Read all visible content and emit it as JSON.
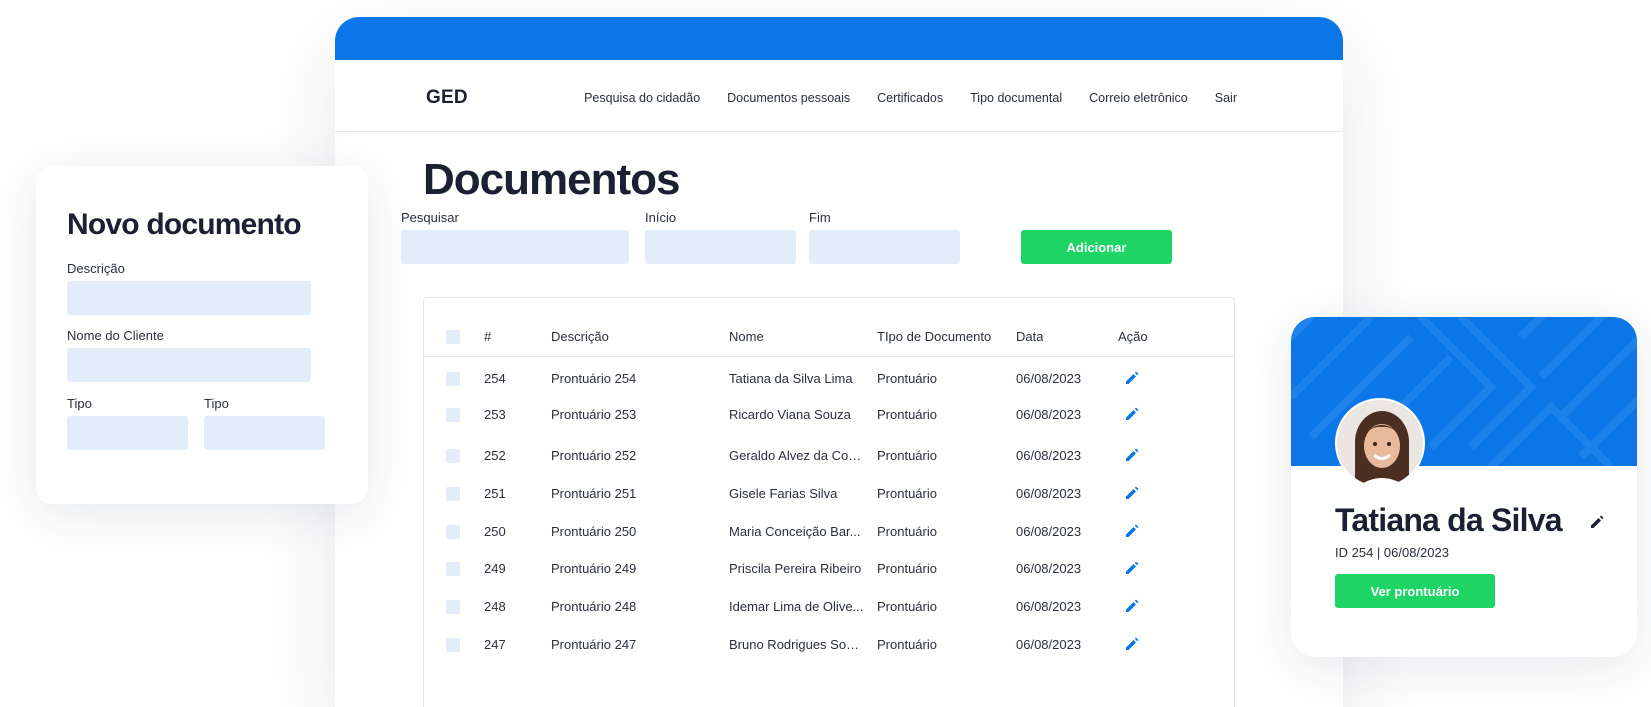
{
  "app": {
    "logo": "GED",
    "nav": [
      "Pesquisa do cidadão",
      "Documentos pessoais",
      "Certificados",
      "Tipo documental",
      "Correio eletrônico",
      "Sair"
    ],
    "page_title": "Documentos",
    "filters": {
      "search_label": "Pesquisar",
      "start_label": "Início",
      "end_label": "Fim",
      "search_value": "",
      "start_value": "",
      "end_value": ""
    },
    "add_button": "Adicionar",
    "colors": {
      "primary": "#0b76e8",
      "accent": "#1dd465",
      "input_bg": "#e3ecf9"
    }
  },
  "table": {
    "headers": [
      "#",
      "Descrição",
      "Nome",
      "TIpo de Documento",
      "Data",
      "Ação"
    ],
    "rows": [
      {
        "id": "254",
        "desc": "Prontuário 254",
        "name": "Tatiana da Silva Lima",
        "type": "Prontuário",
        "date": "06/08/2023"
      },
      {
        "id": "253",
        "desc": "Prontuário 253",
        "name": "Ricardo Viana Souza",
        "type": "Prontuário",
        "date": "06/08/2023"
      },
      {
        "id": "252",
        "desc": "Prontuário 252",
        "name": "Geraldo Alvez da Cos...",
        "type": "Prontuário",
        "date": "06/08/2023"
      },
      {
        "id": "251",
        "desc": "Prontuário 251",
        "name": "Gisele Farias Silva",
        "type": "Prontuário",
        "date": "06/08/2023"
      },
      {
        "id": "250",
        "desc": "Prontuário 250",
        "name": "Maria Conceição Bar...",
        "type": "Prontuário",
        "date": "06/08/2023"
      },
      {
        "id": "249",
        "desc": "Prontuário 249",
        "name": "Priscila Pereira Ribeiro",
        "type": "Prontuário",
        "date": "06/08/2023"
      },
      {
        "id": "248",
        "desc": "Prontuário 248",
        "name": "Idemar Lima de Olive...",
        "type": "Prontuário",
        "date": "06/08/2023"
      },
      {
        "id": "247",
        "desc": "Prontuário 247",
        "name": "Bruno Rodrigues Sou...",
        "type": "Prontuário",
        "date": "06/08/2023"
      }
    ],
    "action_icon": "pencil-icon"
  },
  "form": {
    "title": "Novo documento",
    "descricao_label": "Descrição",
    "cliente_label": "Nome do Cliente",
    "tipo1_label": "Tipo",
    "tipo2_label": "Tipo",
    "descricao_value": "",
    "cliente_value": "",
    "tipo1_value": "",
    "tipo2_value": ""
  },
  "profile": {
    "name": "Tatiana da Silva",
    "meta": "ID 254   |   06/08/2023",
    "button": "Ver prontuário",
    "edit_icon": "pencil-icon",
    "avatar": "avatar-photo"
  }
}
